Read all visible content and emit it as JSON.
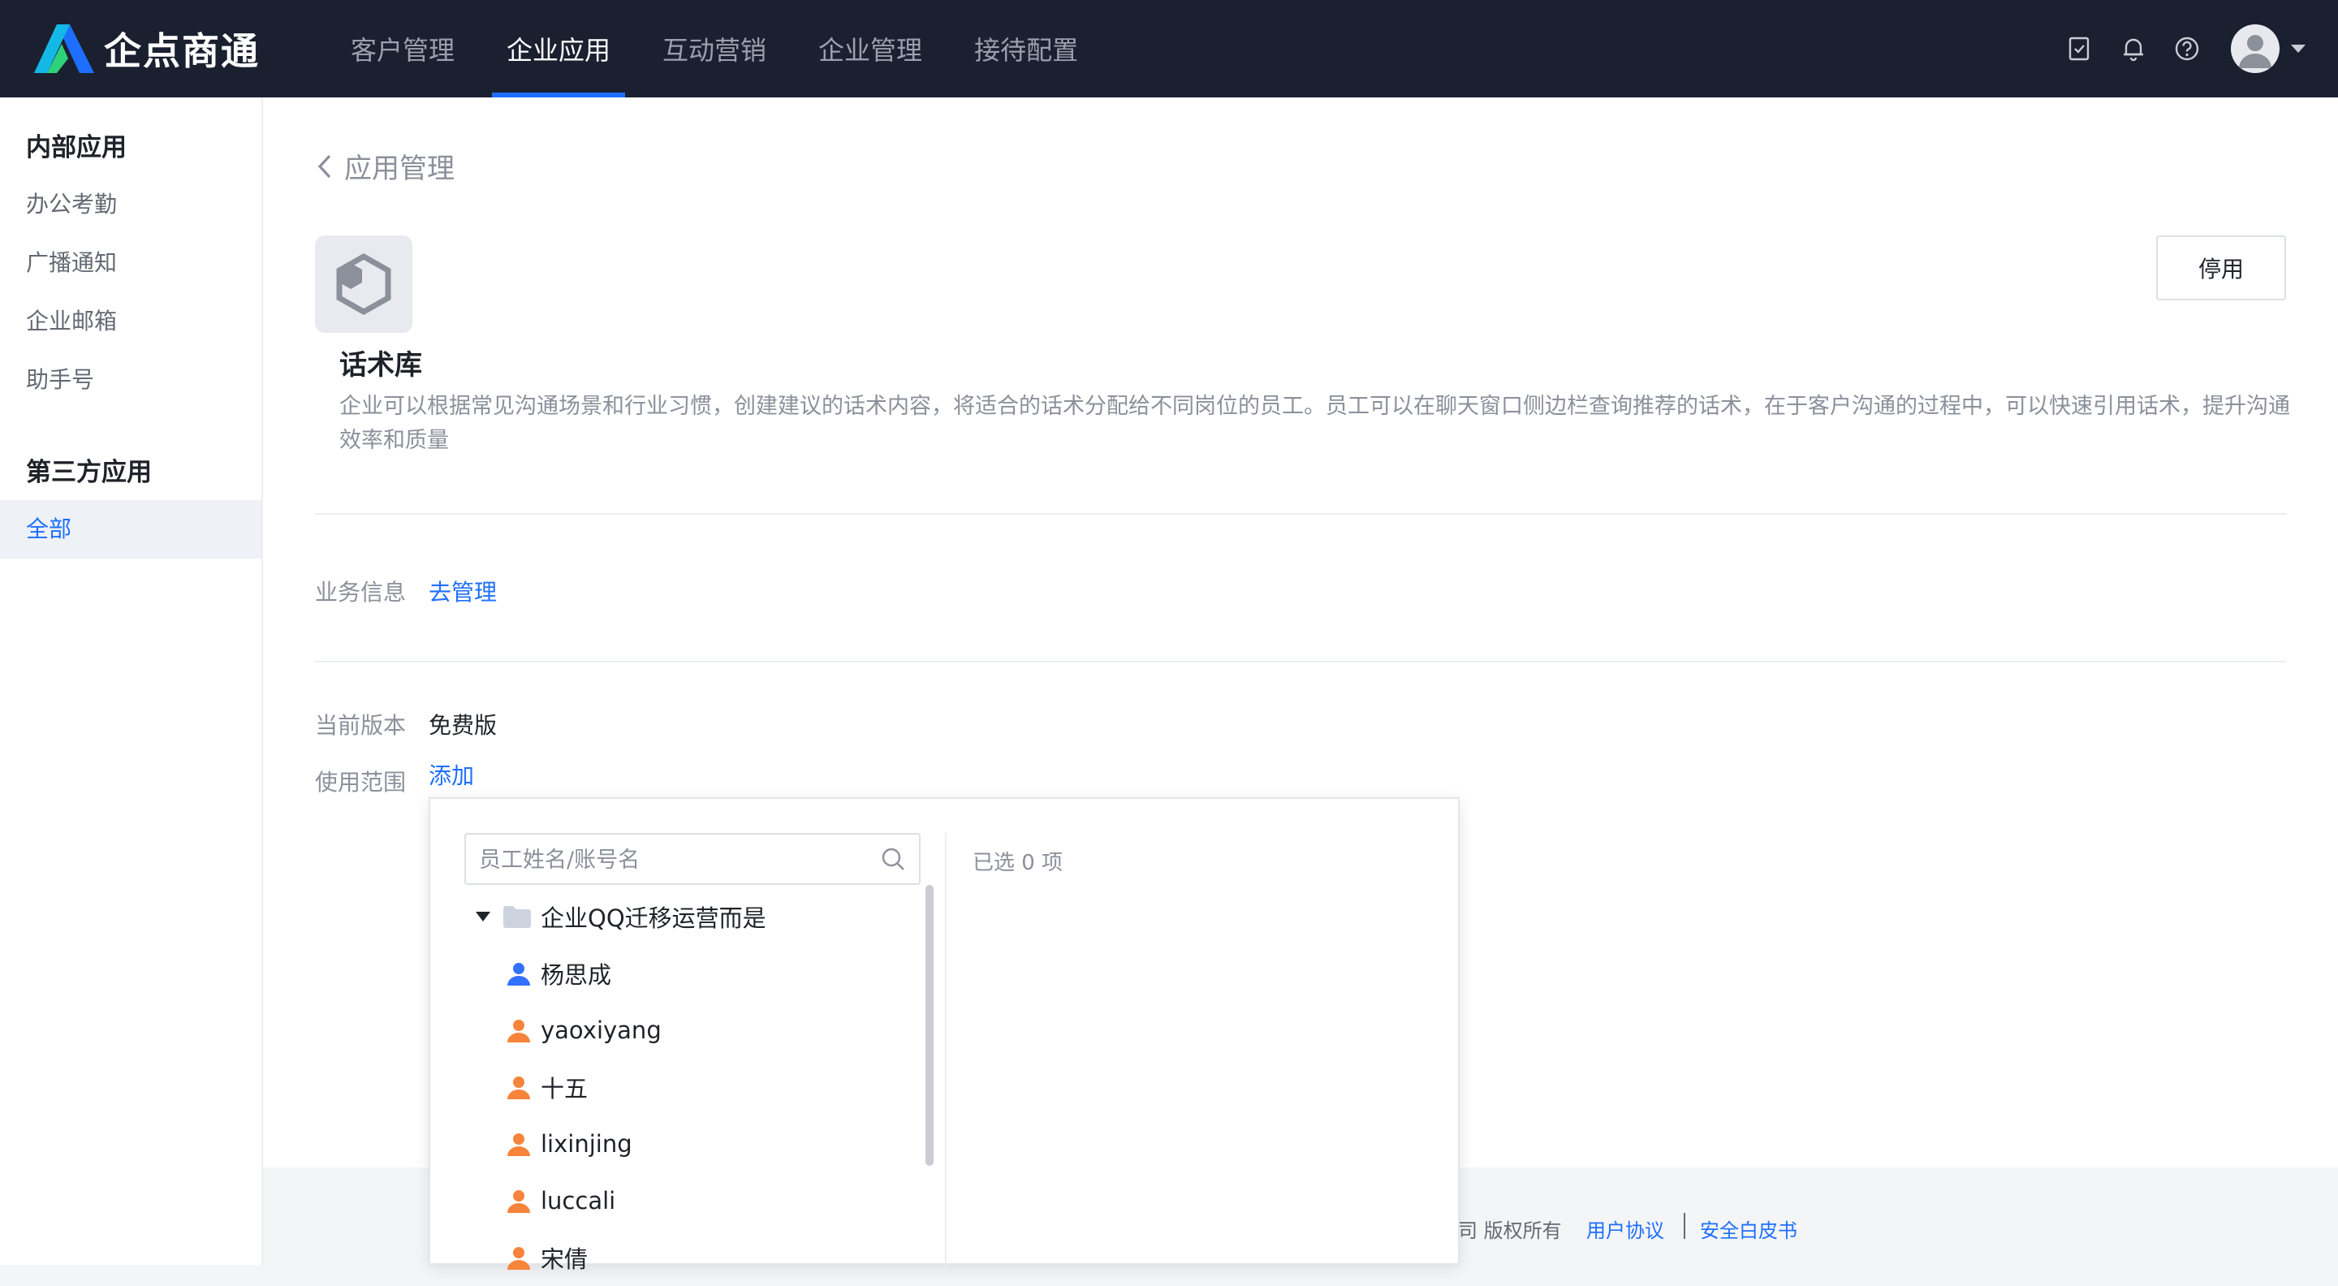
{
  "header": {
    "brand": "企点商通",
    "nav": [
      {
        "label": "客户管理",
        "active": false
      },
      {
        "label": "企业应用",
        "active": true
      },
      {
        "label": "互动营销",
        "active": false
      },
      {
        "label": "企业管理",
        "active": false
      },
      {
        "label": "接待配置",
        "active": false
      }
    ],
    "icons": [
      "checklist-icon",
      "bell-icon",
      "help-icon",
      "avatar"
    ],
    "accent": "#1e6fff"
  },
  "sidebar": {
    "section1_title": "内部应用",
    "section1_items": [
      "办公考勤",
      "广播通知",
      "企业邮箱",
      "助手号"
    ],
    "section2_title": "第三方应用",
    "section2_items": [
      {
        "label": "全部",
        "active": true
      }
    ]
  },
  "main": {
    "back_label": "应用管理",
    "app": {
      "name": "话术库",
      "description": "企业可以根据常见沟通场景和行业习惯，创建建议的话术内容，将适合的话术分配给不同岗位的员工。员工可以在聊天窗口侧边栏查询推荐的话术，在于客户沟通的过程中，可以快速引用话术，提升沟通效率和质量",
      "stop_button": "停用"
    },
    "business_info_label": "业务信息",
    "business_info_link": "去管理",
    "version_label": "当前版本",
    "version_value": "免费版",
    "scope_label": "使用范围",
    "scope_link": "添加"
  },
  "picker": {
    "search_placeholder": "员工姓名/账号名",
    "selected_text": "已选 0 项",
    "group_name": "企业QQ迁移运营而是",
    "members": [
      {
        "name": "杨思成",
        "color": "#3370ff"
      },
      {
        "name": "yaoxiyang",
        "color": "#f7843b"
      },
      {
        "name": "十五",
        "color": "#f7843b"
      },
      {
        "name": "lixinjing",
        "color": "#f7843b"
      },
      {
        "name": "luccali",
        "color": "#f7843b"
      },
      {
        "name": "宋倩",
        "color": "#f7843b"
      }
    ]
  },
  "footer": {
    "copyright": "司 版权所有",
    "user_agreement": "用户协议",
    "security_whitepaper": "安全白皮书"
  }
}
